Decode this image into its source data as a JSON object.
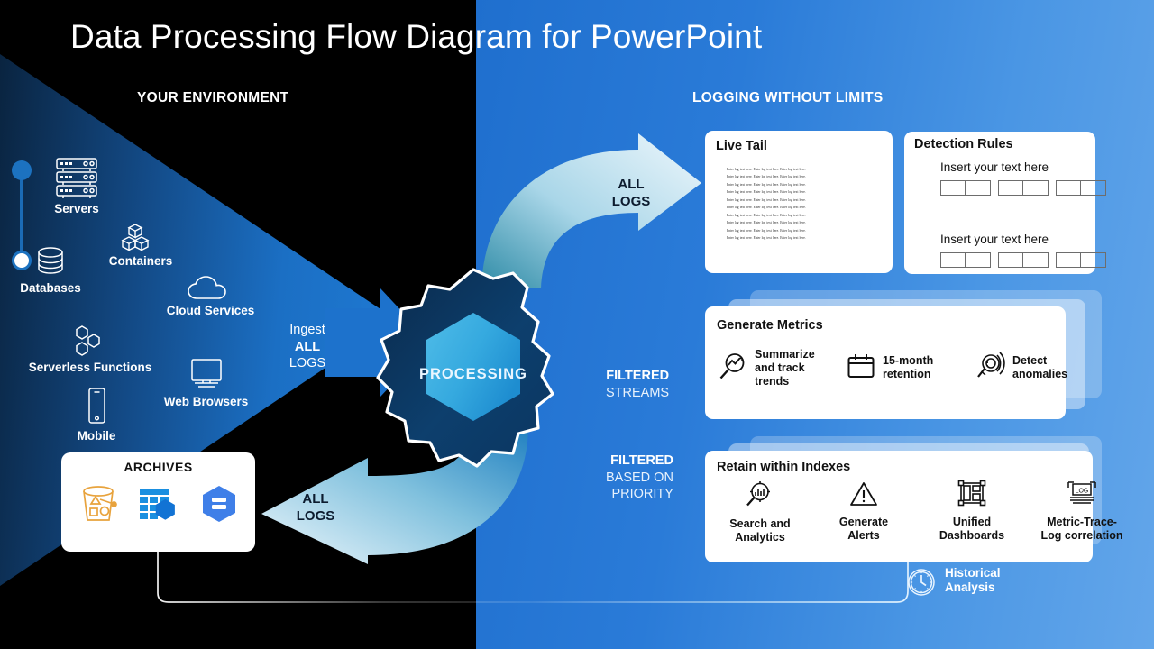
{
  "slide": {
    "title": "Data Processing Flow Diagram for PowerPoint",
    "left_heading": "YOUR ENVIRONMENT",
    "right_heading": "LOGGING WITHOUT LIMITS"
  },
  "colors": {
    "black_bg": "#000000",
    "blue_bg": "#2a7bd8",
    "wedge_blue": "#1b6fc4",
    "accent_blue": "#1c72c0",
    "gear_dark": "#0d3a63",
    "hex_light": "#2eaae0",
    "archive_orange": "#e8a33d",
    "card_white": "#ffffff"
  },
  "sources": [
    {
      "label": "Servers",
      "icon": "server-rack-icon"
    },
    {
      "label": "Containers",
      "icon": "containers-icon"
    },
    {
      "label": "Databases",
      "icon": "database-icon"
    },
    {
      "label": "Cloud Services",
      "icon": "cloud-icon"
    },
    {
      "label": "Serverless Functions",
      "icon": "serverless-hexagons-icon"
    },
    {
      "label": "Web Browsers",
      "icon": "monitor-icon"
    },
    {
      "label": "Mobile",
      "icon": "mobile-phone-icon"
    }
  ],
  "ingest": {
    "line1": "Ingest",
    "line2": "ALL",
    "line3": "LOGS"
  },
  "processing": {
    "label": "PROCESSING"
  },
  "arrows": {
    "top": {
      "line1": "ALL",
      "line2": "LOGS"
    },
    "bottom": {
      "line1": "ALL",
      "line2": "LOGS"
    }
  },
  "archives": {
    "title": "ARCHIVES",
    "icons": [
      "s3-bucket-icon",
      "bigquery-table-icon",
      "storage-hexagon-icon"
    ]
  },
  "live_tail": {
    "title": "Live Tail",
    "log_line": "Enter log text here. Enter log text here. Enter log text here.",
    "line_count": 10
  },
  "detection_rules": {
    "title": "Detection Rules",
    "items": [
      {
        "text": "Insert your text here",
        "marker": "filled"
      },
      {
        "text": "Insert your text here",
        "marker": "hollow"
      }
    ],
    "cell_groups": 3,
    "cells_per_group": 2
  },
  "filtered_streams": {
    "bold": "FILTERED",
    "rest": "STREAMS"
  },
  "filtered_priority": {
    "bold": "FILTERED",
    "rest_1": "BASED ON",
    "rest_2": "PRIORITY"
  },
  "metrics": {
    "title": "Generate Metrics",
    "features": [
      {
        "label": "Summarize and track trends",
        "icon": "magnifier-trend-icon"
      },
      {
        "label": "15-month retention",
        "icon": "calendar-icon"
      },
      {
        "label": "Detect anomalies",
        "icon": "anomaly-radar-icon"
      }
    ]
  },
  "retain": {
    "title": "Retain within Indexes",
    "features": [
      {
        "label": "Search and Analytics",
        "icon": "magnifier-chart-icon"
      },
      {
        "label": "Generate Alerts",
        "icon": "warning-triangle-icon"
      },
      {
        "label": "Unified Dashboards",
        "icon": "dashboard-layout-icon"
      },
      {
        "label": "Metric-Trace-Log correlation",
        "icon": "log-box-icon"
      }
    ]
  },
  "historical": {
    "line1": "Historical",
    "line2": "Analysis",
    "icon": "clock-icon"
  }
}
